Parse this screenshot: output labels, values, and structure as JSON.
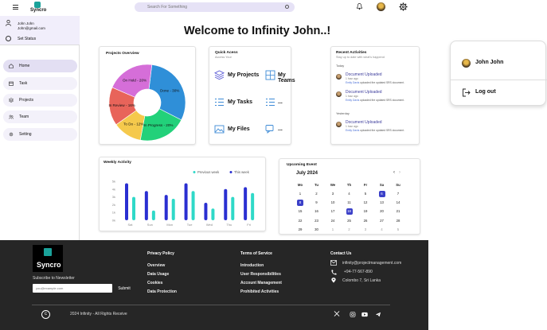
{
  "header": {
    "app_name": "Syncro",
    "search_placeholder": "Search For Something"
  },
  "sidebar": {
    "user_name": "John John",
    "user_email": "John@gmail.com",
    "set_status": "Set Status",
    "items": [
      {
        "label": "Home",
        "icon": "home-icon",
        "active": true
      },
      {
        "label": "Task",
        "icon": "calendar-icon",
        "active": false
      },
      {
        "label": "Projects",
        "icon": "layers-icon",
        "active": false
      },
      {
        "label": "Team",
        "icon": "team-icon",
        "active": false
      },
      {
        "label": "Setting",
        "icon": "gear-icon",
        "active": false
      }
    ]
  },
  "main": {
    "welcome": "Welcome to Infinity John..!"
  },
  "projects_overview": {
    "title": "Projects Overview",
    "chart_data": {
      "type": "pie",
      "categories": [
        "Done",
        "In Progress",
        "To Do",
        "In Review",
        "On Hold"
      ],
      "values": [
        30,
        20,
        12,
        16,
        20
      ],
      "labels": [
        "Done - 30%",
        "In Progress - 20%",
        "To Do - 12%",
        "In Review - 16%",
        "On Hold - 20%"
      ],
      "colors": [
        "#2f8fd8",
        "#22d17a",
        "#f5c94c",
        "#e8645a",
        "#d56ed8"
      ]
    }
  },
  "quick_access": {
    "title": "Quick Acess",
    "subtitle": "Access Your",
    "items": [
      "My Projects",
      "My Teams",
      "My Tasks",
      "...",
      "My Files",
      "..."
    ]
  },
  "recent_activities": {
    "title": "Recent Activities",
    "subtitle": "Stay up to date with what's happend",
    "groups": [
      {
        "day": "Today",
        "items": [
          {
            "title": "Document Uploaded",
            "time": "1 hour ago",
            "user": "Emily Davis",
            "desc": "uploaded the updated SRS document."
          },
          {
            "title": "Document Uploaded",
            "time": "1 hour ago",
            "user": "Emily Davis",
            "desc": "uploaded the updated SRS document."
          }
        ]
      },
      {
        "day": "Yesterday",
        "items": [
          {
            "title": "Document Uploaded",
            "time": "1 hour ago",
            "user": "Emily Davis",
            "desc": "uploaded the updated SRS document."
          }
        ]
      }
    ]
  },
  "weekly_activity": {
    "title": "Weekly Activity",
    "chart_data": {
      "type": "bar",
      "categories": [
        "Sat",
        "Sun",
        "Mon",
        "Tue",
        "Wed",
        "Thu",
        "Fri"
      ],
      "series": [
        {
          "name": "Previous week",
          "values": [
            6,
            2.5,
            5.5,
            7.5,
            3,
            6,
            7
          ],
          "color": "#2fd9c8"
        },
        {
          "name": "This week",
          "values": [
            9.5,
            7.5,
            6.5,
            9.5,
            4.5,
            8,
            8.5
          ],
          "color": "#2a2fd1"
        }
      ],
      "ytick_labels": [
        "0k",
        "1k",
        "2k",
        "3k",
        "4k",
        "5k"
      ],
      "ylim": [
        0,
        10
      ]
    }
  },
  "upcoming_event": {
    "title": "Upcoming Event",
    "month": "July 2024",
    "weekdays": [
      "Mo",
      "Tu",
      "We",
      "Th",
      "Fr",
      "Sa",
      "Su"
    ],
    "weeks": [
      [
        "1",
        "2",
        "3",
        "4",
        "5",
        "6",
        "7"
      ],
      [
        "8",
        "9",
        "10",
        "11",
        "12",
        "13",
        "14"
      ],
      [
        "15",
        "16",
        "17",
        "18",
        "19",
        "20",
        "21"
      ],
      [
        "22",
        "23",
        "24",
        "25",
        "26",
        "27",
        "28"
      ],
      [
        "29",
        "30",
        "1",
        "2",
        "3",
        "4",
        "5"
      ]
    ],
    "highlighted": [
      "6",
      "8",
      "18"
    ],
    "accent": "#3b40c8"
  },
  "profile_menu": {
    "name": "John John",
    "logout": "Log out"
  },
  "footer": {
    "logo_text": "Syncro",
    "subscribe_label": "Subscribe to Newsletter",
    "email_placeholder": "you@example.com",
    "submit": "Submit",
    "privacy": {
      "heading": "Privacy Policy",
      "links": [
        "Overview",
        "Data Usage",
        "Cookies",
        "Data Protection"
      ]
    },
    "terms": {
      "heading": "Terms of Service",
      "links": [
        "Introduction",
        "User Responsibilities",
        "Account Management",
        "Prohibited Activities"
      ]
    },
    "contact": {
      "heading": "Contact Us",
      "email": "infinity@projectmanagement.com",
      "phone": "+94-77-567-890",
      "address": "Colombo 7, Sri Lanka"
    },
    "copyright": "2024 Infinity - All Rights Receive"
  }
}
